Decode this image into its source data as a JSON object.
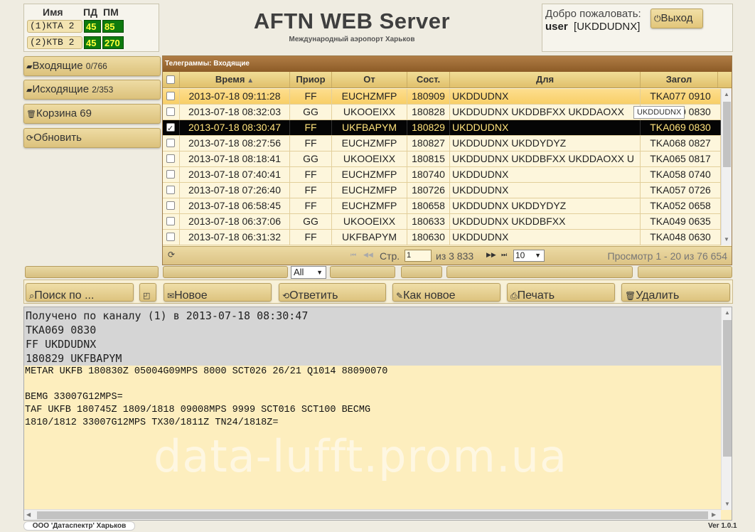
{
  "channels": {
    "headers": {
      "name": "Имя",
      "pd": "ПД",
      "pm": "ПМ"
    },
    "items": [
      {
        "label": "(1)КТА 2",
        "pd": "45",
        "pm": "85"
      },
      {
        "label": "(2)КТВ 2",
        "pd": "45",
        "pm": "270"
      }
    ]
  },
  "header": {
    "title": "AFTN WEB Server",
    "subtitle": "Международный аэропорт Харьков"
  },
  "user": {
    "welcome": "Добро пожаловать:",
    "name": "user",
    "code": "[UKDDUDNX]",
    "logout_label": "Выход"
  },
  "sidebar": {
    "items": [
      {
        "label": "Входящие",
        "count": "0/766"
      },
      {
        "label": "Исходящие",
        "count": "2/353"
      },
      {
        "label": "Корзина 69",
        "count": ""
      },
      {
        "label": "Обновить",
        "count": ""
      }
    ]
  },
  "grid": {
    "caption": "Телеграммы: Входящие",
    "columns": [
      "Время",
      "Приор",
      "От",
      "Сост.",
      "Для",
      "Загол"
    ],
    "rows": [
      {
        "time": "2013-07-18 09:11:28",
        "prio": "FF",
        "from": "EUCHZMFP",
        "sost": "180909",
        "to": "UKDDUDNX",
        "head": "TKA077 0910"
      },
      {
        "time": "2013-07-18 08:32:03",
        "prio": "GG",
        "from": "UKOOEIXX",
        "sost": "180828",
        "to": "UKDDUDNX UKDDBFXX UKDDAOXX",
        "head": "TKA070 0830"
      },
      {
        "time": "2013-07-18 08:30:47",
        "prio": "FF",
        "from": "UKFBAPYM",
        "sost": "180829",
        "to": "UKDDUDNX",
        "head": "TKA069 0830"
      },
      {
        "time": "2013-07-18 08:27:56",
        "prio": "FF",
        "from": "EUCHZMFP",
        "sost": "180827",
        "to": "UKDDUDNX UKDDYDYZ",
        "head": "TKA068 0827"
      },
      {
        "time": "2013-07-18 08:18:41",
        "prio": "GG",
        "from": "UKOOEIXX",
        "sost": "180815",
        "to": "UKDDUDNX UKDDBFXX UKDDAOXX U",
        "head": "TKA065 0817"
      },
      {
        "time": "2013-07-18 07:40:41",
        "prio": "FF",
        "from": "EUCHZMFP",
        "sost": "180740",
        "to": "UKDDUDNX",
        "head": "TKA058 0740"
      },
      {
        "time": "2013-07-18 07:26:40",
        "prio": "FF",
        "from": "EUCHZMFP",
        "sost": "180726",
        "to": "UKDDUDNX",
        "head": "TKA057 0726"
      },
      {
        "time": "2013-07-18 06:58:45",
        "prio": "FF",
        "from": "EUCHZMFP",
        "sost": "180658",
        "to": "UKDDUDNX UKDDYDYZ",
        "head": "TKA052 0658"
      },
      {
        "time": "2013-07-18 06:37:06",
        "prio": "GG",
        "from": "UKOOEIXX",
        "sost": "180633",
        "to": "UKDDUDNX UKDDBFXX",
        "head": "TKA049 0635"
      },
      {
        "time": "2013-07-18 06:31:32",
        "prio": "FF",
        "from": "UKFBAPYM",
        "sost": "180630",
        "to": "UKDDUDNX",
        "head": "TKA048 0630"
      }
    ],
    "tooltip": "UKDDUDNX",
    "pager": {
      "page_label": "Стр.",
      "page_value": "1",
      "of_label": "из 3 833",
      "page_size": "10",
      "view_text": "Просмотр 1 - 20 из 76 654"
    },
    "filter_value": "All"
  },
  "toolbar": {
    "search": "Поиск по ...",
    "new": "Новое",
    "reply": "Ответить",
    "as_new": "Как новое",
    "print": "Печать",
    "delete": "Удалить"
  },
  "message": {
    "header_lines": [
      "Получено по каналу (1) в 2013-07-18 08:30:47",
      "TKA069 0830",
      "FF UKDDUDNX",
      "180829 UKFBAPYM"
    ],
    "body": "METAR UKFB 180830Z 05004G09MPS 8000 SCT026 26/21 Q1014 88090070\n\nBEMG 33007G12MPS=\nTAF UKFB 180745Z 1809/1818 09008MPS 9999 SCT016 SCT100 BECMG\n1810/1812 33007G12MPS TX30/1811Z TN24/1818Z="
  },
  "watermark": "data-lufft.prom.ua",
  "footer": {
    "company": "ООО 'Датаспектр' Харьков",
    "version": "Ver 1.0.1"
  }
}
